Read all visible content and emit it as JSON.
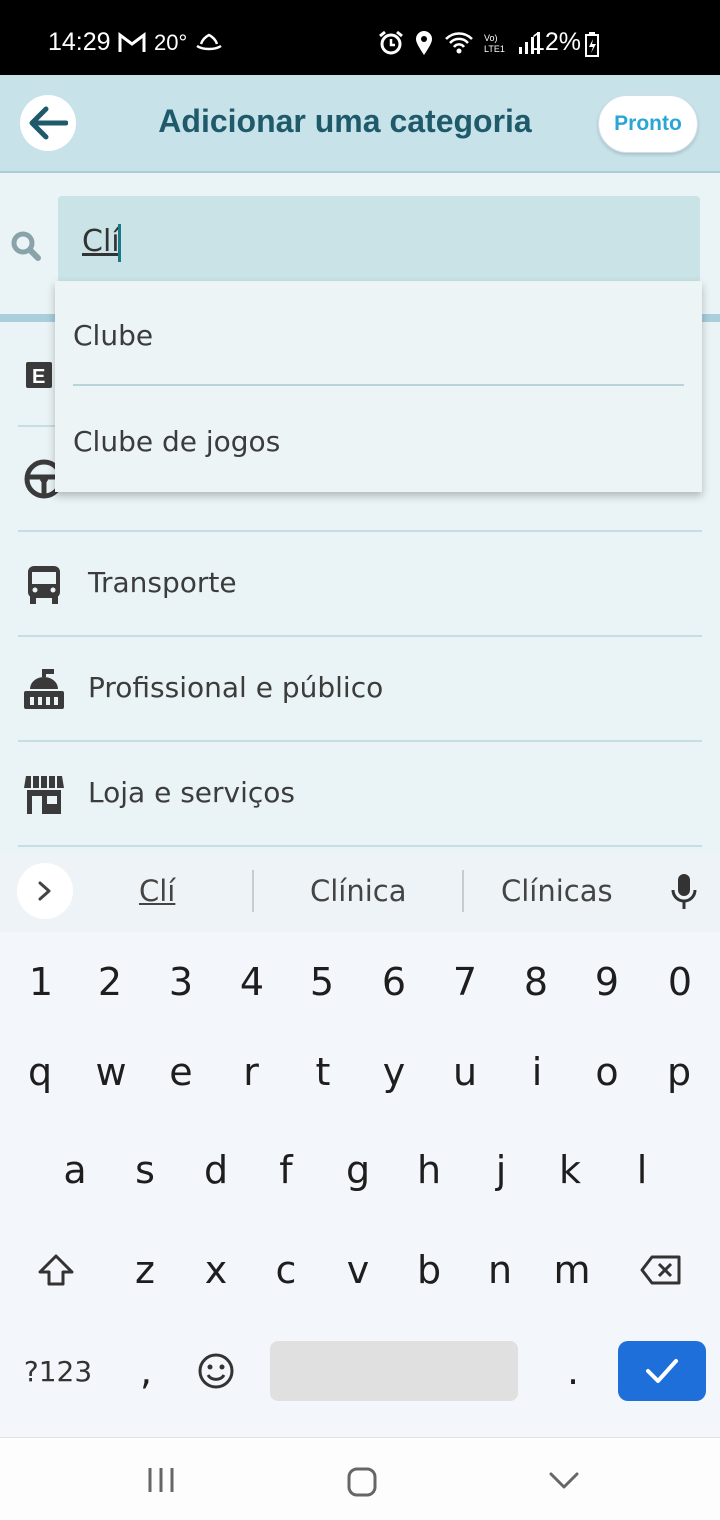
{
  "status_bar": {
    "time": "14:29",
    "temperature": "20°",
    "battery": "12%",
    "left_icons": [
      "gmail-icon",
      "weather-icon",
      "boat-icon"
    ],
    "right_icons": [
      "alarm-icon",
      "location-icon",
      "wifi-icon",
      "volte-icon",
      "signal-icon"
    ]
  },
  "header": {
    "title": "Adicionar uma categoria",
    "done_label": "Pronto",
    "back_icon": "arrow-left-icon"
  },
  "search": {
    "value": "Clí",
    "icon": "search-icon"
  },
  "dropdown": {
    "items": [
      "Clube",
      "Clube de jogos"
    ]
  },
  "list": {
    "items": [
      {
        "label": "",
        "icon": "e-box-icon"
      },
      {
        "label": "",
        "icon": "steering-wheel-icon"
      },
      {
        "label": "Transporte",
        "icon": "bus-icon"
      },
      {
        "label": "Profissional e público",
        "icon": "government-building-icon"
      },
      {
        "label": "Loja e serviços",
        "icon": "store-icon"
      }
    ]
  },
  "suggestions": {
    "items": [
      "Clí",
      "Clínica",
      "Clínicas"
    ]
  },
  "keyboard": {
    "row_numbers": [
      "1",
      "2",
      "3",
      "4",
      "5",
      "6",
      "7",
      "8",
      "9",
      "0"
    ],
    "row1": [
      "q",
      "w",
      "e",
      "r",
      "t",
      "y",
      "u",
      "i",
      "o",
      "p"
    ],
    "row2": [
      "a",
      "s",
      "d",
      "f",
      "g",
      "h",
      "j",
      "k",
      "l"
    ],
    "row3": [
      "z",
      "x",
      "c",
      "v",
      "b",
      "n",
      "m"
    ],
    "symbols_label": "?123",
    "comma": ",",
    "period": ".",
    "enter_color": "#1f6fdb"
  },
  "colors": {
    "header_bg": "#c7e2e9",
    "title": "#1f5a6b",
    "accent": "#2aa6d6",
    "search_bg": "#c9e3e6"
  }
}
